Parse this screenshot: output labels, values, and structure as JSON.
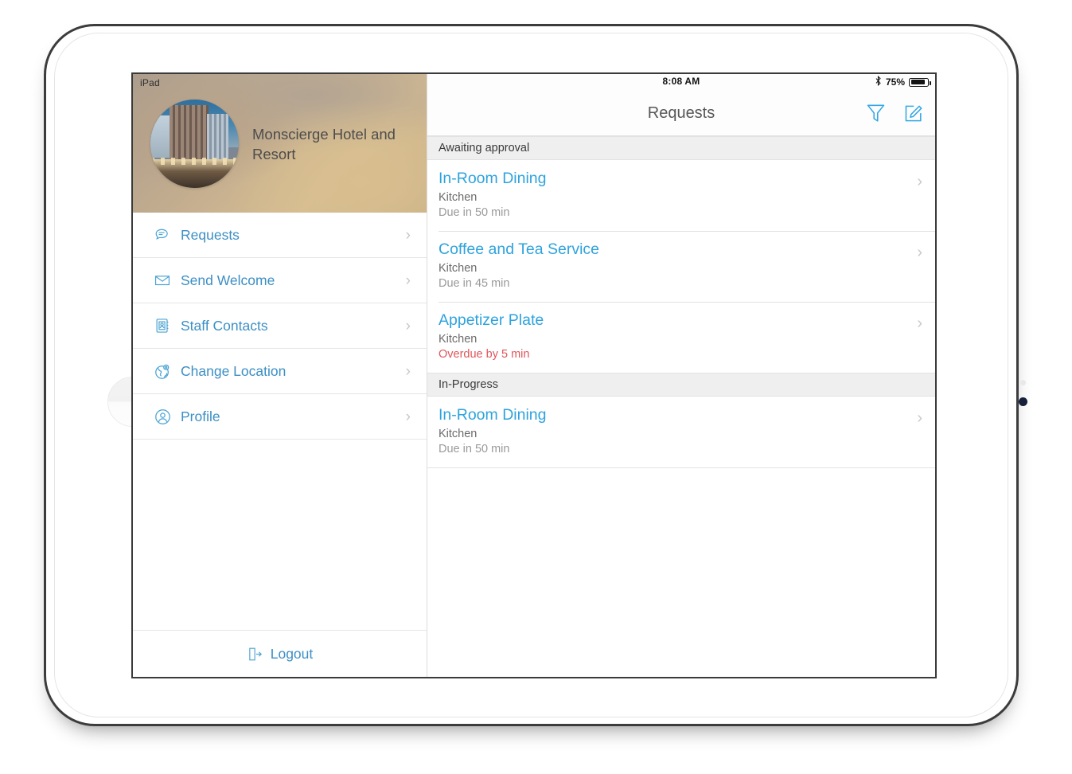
{
  "device": {
    "status_label": "iPad"
  },
  "statusbar": {
    "time": "8:08 AM",
    "battery_percent": "75%",
    "bluetooth_icon": "bluetooth-icon",
    "battery_icon": "battery-icon"
  },
  "sidebar": {
    "hotel": {
      "name": "Monscierge Hotel and Resort",
      "avatar_icon": "hotel-building-photo"
    },
    "items": [
      {
        "label": "Requests",
        "icon": "chat-bubble-icon",
        "chevron": "›"
      },
      {
        "label": "Send Welcome",
        "icon": "envelope-icon",
        "chevron": "›"
      },
      {
        "label": "Staff Contacts",
        "icon": "address-book-icon",
        "chevron": "›"
      },
      {
        "label": "Change Location",
        "icon": "globe-pin-icon",
        "chevron": "›"
      },
      {
        "label": "Profile",
        "icon": "person-circle-icon",
        "chevron": "›"
      }
    ],
    "logout": {
      "label": "Logout",
      "icon": "logout-icon"
    }
  },
  "navbar": {
    "title": "Requests",
    "filter_icon": "filter-funnel-icon",
    "compose_icon": "compose-edit-icon"
  },
  "requests": {
    "sections": [
      {
        "header": "Awaiting approval",
        "items": [
          {
            "title": "In-Room Dining",
            "department": "Kitchen",
            "due": "Due in 50 min",
            "overdue": false,
            "chevron": "›"
          },
          {
            "title": "Coffee and Tea Service",
            "department": "Kitchen",
            "due": "Due in 45 min",
            "overdue": false,
            "chevron": "›"
          },
          {
            "title": "Appetizer Plate",
            "department": "Kitchen",
            "due": "Overdue by 5 min",
            "overdue": true,
            "chevron": "›"
          }
        ]
      },
      {
        "header": "In-Progress",
        "items": [
          {
            "title": "In-Room Dining",
            "department": "Kitchen",
            "due": "Due in 50 min",
            "overdue": false,
            "chevron": "›"
          }
        ]
      }
    ]
  },
  "colors": {
    "accent_blue": "#2ea3dd",
    "sidebar_blue": "#3c8fc4",
    "overdue_red": "#e0555a",
    "section_gray": "#efeff0"
  }
}
